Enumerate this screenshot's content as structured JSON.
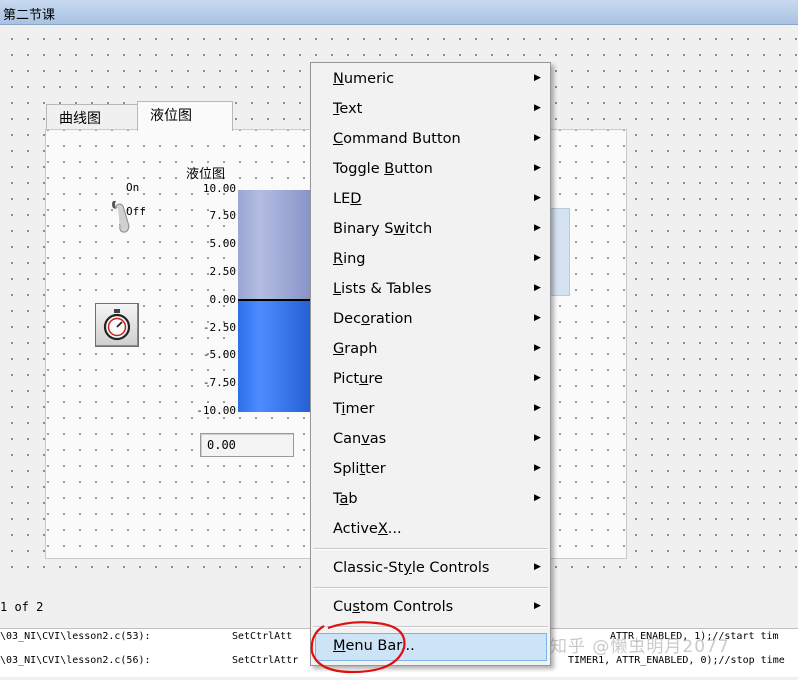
{
  "window": {
    "title": "第二节课"
  },
  "tabs": [
    {
      "label": "曲线图",
      "active": false
    },
    {
      "label": "液位图",
      "active": true
    }
  ],
  "binary_switch": {
    "on_label": "On",
    "off_label": "Off"
  },
  "tank": {
    "title": "液位图",
    "ticks": [
      "10.00",
      "7.50",
      "5.00",
      "2.50",
      "0.00",
      "-2.50",
      "-5.00",
      "-7.50",
      "-10.00"
    ],
    "value_display": "0.00",
    "level": 0.0
  },
  "status": {
    "page_text": "1 of 2"
  },
  "code_lines": [
    {
      "location": "\\03_NI\\CVI\\lesson2.c(53):",
      "code": "SetCtrlAtt"
    },
    {
      "location": "\\03_NI\\CVI\\lesson2.c(56):",
      "code": "SetCtrlAttr"
    }
  ],
  "code_right": [
    "ATTR_ENABLED, 1);//start tim",
    "TIMER1, ATTR_ENABLED, 0);//stop time"
  ],
  "watermark": "知乎 @懒虫明月2077",
  "menu": {
    "groups": [
      [
        {
          "label": "Numeric",
          "mn": "N",
          "submenu": true
        },
        {
          "label": "Text",
          "mn": "T",
          "submenu": true
        },
        {
          "label": "Command Button",
          "mn": "C",
          "submenu": true
        },
        {
          "label": "Toggle Button",
          "mn": "B",
          "submenu": true
        },
        {
          "label": "LED",
          "mn": "D",
          "submenu": true
        },
        {
          "label": "Binary Switch",
          "mn": "w",
          "submenu": true
        },
        {
          "label": "Ring",
          "mn": "R",
          "submenu": true
        },
        {
          "label": "Lists & Tables",
          "mn": "L",
          "submenu": true
        },
        {
          "label": "Decoration",
          "mn": "o",
          "submenu": true
        },
        {
          "label": "Graph",
          "mn": "G",
          "submenu": true
        },
        {
          "label": "Picture",
          "mn": "u",
          "submenu": true
        },
        {
          "label": "Timer",
          "mn": "i",
          "submenu": true
        },
        {
          "label": "Canvas",
          "mn": "v",
          "submenu": true
        },
        {
          "label": "Splitter",
          "mn": "t",
          "submenu": true
        },
        {
          "label": "Tab",
          "mn": "a",
          "submenu": true
        },
        {
          "label": "ActiveX...",
          "mn": "X",
          "submenu": false
        }
      ],
      [
        {
          "label": "Classic-Style Controls",
          "mn": "y",
          "submenu": true
        }
      ],
      [
        {
          "label": "Custom Controls",
          "mn": "s",
          "submenu": true
        }
      ],
      [
        {
          "label": "Menu Bar...",
          "mn": "M",
          "submenu": false,
          "highlighted": true
        }
      ]
    ]
  },
  "colors": {
    "highlight": "#cde4f7",
    "annotation": "#e01010"
  }
}
